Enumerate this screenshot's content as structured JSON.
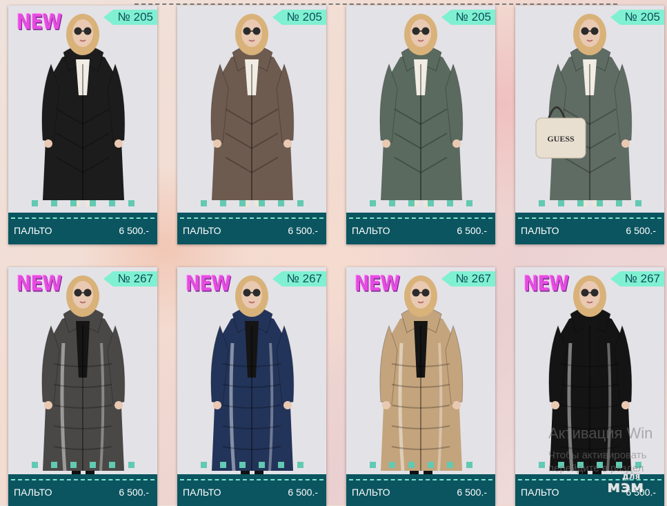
{
  "products": [
    {
      "new": true,
      "new_label": "NEW",
      "number": "№ 205",
      "name": "ПАЛЬТО",
      "price": "6 500.-",
      "coat_color": "#1c1c1c",
      "style": "matte"
    },
    {
      "new": false,
      "new_label": "",
      "number": "№ 205",
      "name": "ПАЛЬТО",
      "price": "6 500.-",
      "coat_color": "#6e5b4f",
      "style": "matte"
    },
    {
      "new": false,
      "new_label": "",
      "number": "№ 205",
      "name": "ПАЛЬТО",
      "price": "6 500.-",
      "coat_color": "#5b6a5f",
      "style": "matte"
    },
    {
      "new": false,
      "new_label": "",
      "number": "№ 205",
      "name": "ПАЛЬТО",
      "price": "6 500.-",
      "coat_color": "#5f6c63",
      "style": "matte",
      "bag_label": "GUESS"
    },
    {
      "new": true,
      "new_label": "NEW",
      "number": "№ 267",
      "name": "ПАЛЬТО",
      "price": "6 500.-",
      "coat_color": "#4a4846",
      "style": "glossy"
    },
    {
      "new": true,
      "new_label": "NEW",
      "number": "№ 267",
      "name": "ПАЛЬТО",
      "price": "6 500.-",
      "coat_color": "#23345a",
      "style": "glossy"
    },
    {
      "new": true,
      "new_label": "NEW",
      "number": "№ 267",
      "name": "ПАЛЬТО",
      "price": "6 500.-",
      "coat_color": "#c4a47c",
      "style": "glossy"
    },
    {
      "new": true,
      "new_label": "NEW",
      "number": "№ 267",
      "name": "ПАЛЬТО",
      "price": "6 500.-",
      "coat_color": "#141414",
      "style": "glossy"
    }
  ],
  "carousel_dots": 6,
  "colors": {
    "footer": "#0b5560",
    "badge": "#80f0d2",
    "new": "#e44ce0",
    "dots": "#62c9b2"
  },
  "watermark": {
    "title": "Активация Win",
    "subtitle": "Чтобы активировать перейдите в раздел"
  },
  "logo": {
    "small": "для",
    "main": "мэм"
  }
}
